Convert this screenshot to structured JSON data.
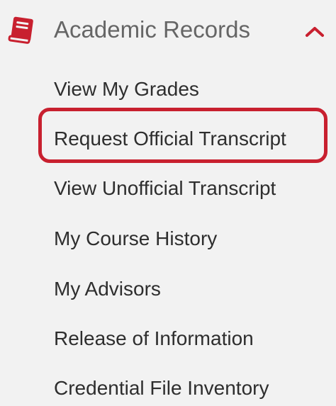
{
  "section": {
    "title": "Academic Records",
    "icon": "book-icon",
    "collapse_icon": "chevron-up-icon",
    "accent_color": "#c8202f",
    "expanded": true
  },
  "menu": {
    "items": [
      {
        "label": "View My Grades",
        "highlighted": false
      },
      {
        "label": "Request Official Transcript",
        "highlighted": true
      },
      {
        "label": "View Unofficial Transcript",
        "highlighted": false
      },
      {
        "label": "My Course History",
        "highlighted": false
      },
      {
        "label": "My Advisors",
        "highlighted": false
      },
      {
        "label": "Release of Information",
        "highlighted": false
      },
      {
        "label": "Credential File Inventory",
        "highlighted": false
      }
    ]
  },
  "highlight": {
    "color": "#c8202f"
  }
}
